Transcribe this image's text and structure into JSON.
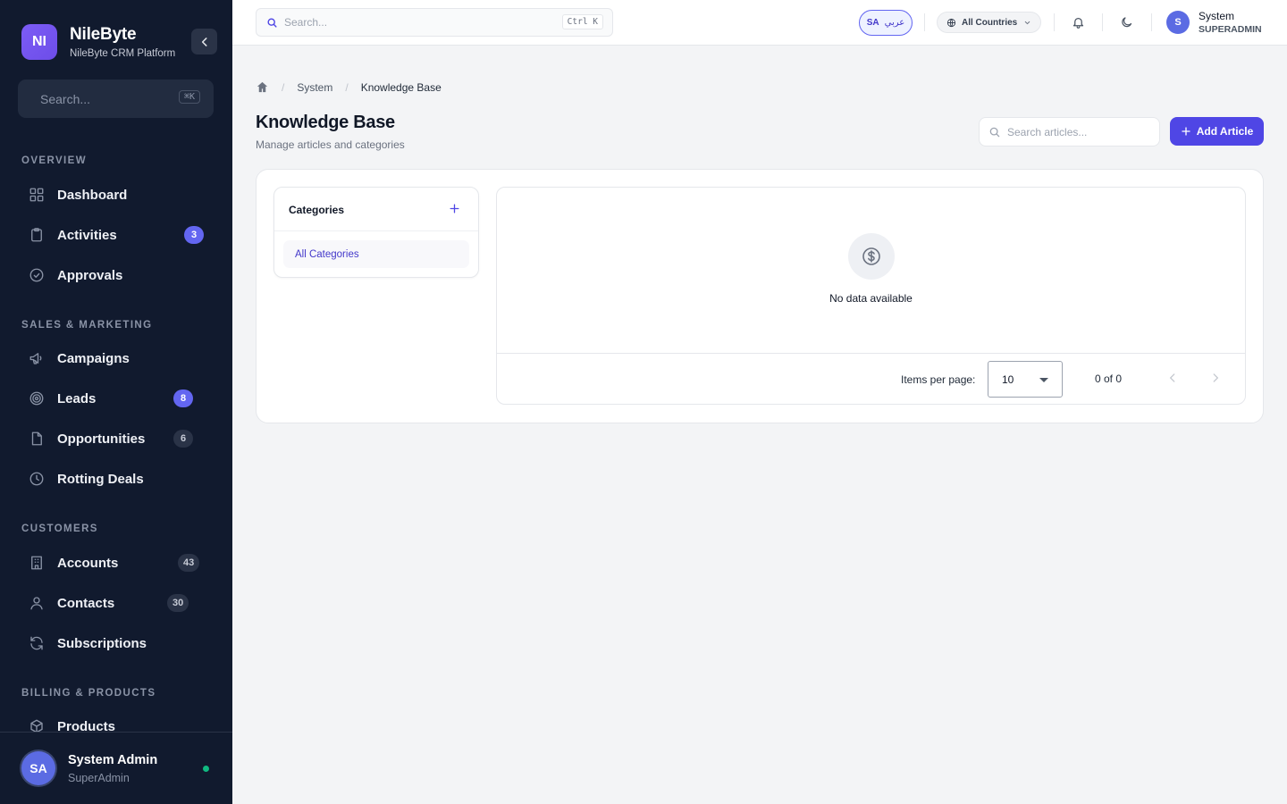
{
  "brand": {
    "logo": "NI",
    "name": "NileByte",
    "subtitle": "NileByte CRM Platform"
  },
  "sidebar": {
    "search_placeholder": "Search...",
    "search_shortcut": "⌘K",
    "sections": [
      {
        "title": "OVERVIEW"
      },
      {
        "title": "SALES & MARKETING"
      },
      {
        "title": "CUSTOMERS"
      },
      {
        "title": "BILLING & PRODUCTS"
      }
    ],
    "items": [
      {
        "label": "Dashboard",
        "icon": "grid-icon"
      },
      {
        "label": "Activities",
        "icon": "clipboard-icon",
        "badge": "3"
      },
      {
        "label": "Approvals",
        "icon": "check-circle-icon"
      },
      {
        "label": "Campaigns",
        "icon": "megaphone-icon"
      },
      {
        "label": "Leads",
        "icon": "target-icon",
        "badge": "8"
      },
      {
        "label": "Opportunities",
        "icon": "file-icon",
        "badge": "6"
      },
      {
        "label": "Rotting Deals",
        "icon": "clock-icon"
      },
      {
        "label": "Accounts",
        "icon": "building-icon",
        "badge": "43"
      },
      {
        "label": "Contacts",
        "icon": "user-icon",
        "badge": "30"
      },
      {
        "label": "Subscriptions",
        "icon": "refresh-icon"
      },
      {
        "label": "Products",
        "icon": "box-icon"
      }
    ],
    "footer": {
      "initials": "SA",
      "name": "System Admin",
      "role": "SuperAdmin"
    }
  },
  "topbar": {
    "search_placeholder": "Search...",
    "search_shortcut": "Ctrl K",
    "lang_code": "SA",
    "lang_label": "عربي",
    "country": "All Countries",
    "user": {
      "initial": "S",
      "name": "System",
      "role": "SUPERADMIN"
    }
  },
  "breadcrumb": {
    "items": [
      "System",
      "Knowledge Base"
    ]
  },
  "page": {
    "title": "Knowledge Base",
    "subtitle": "Manage articles and categories",
    "search_placeholder": "Search articles...",
    "add_label": "Add Article"
  },
  "categories": {
    "title": "Categories",
    "items": [
      "All Categories"
    ]
  },
  "table": {
    "empty_text": "No data available",
    "items_per_page_label": "Items per page:",
    "items_per_page": "10",
    "range": "0 of 0"
  },
  "colors": {
    "sidebar_bg": "#111a2e",
    "accent": "#4f46e5",
    "badge": "#6366f1",
    "online": "#10b981"
  }
}
